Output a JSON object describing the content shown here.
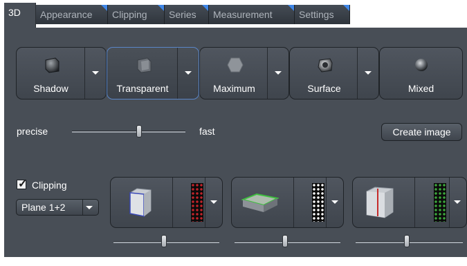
{
  "tabs": [
    {
      "label": "3D",
      "active": true
    },
    {
      "label": "Appearance",
      "active": false
    },
    {
      "label": "Clipping",
      "active": false
    },
    {
      "label": "Series",
      "active": false
    },
    {
      "label": "Measurement",
      "active": false
    },
    {
      "label": "Settings",
      "active": false
    }
  ],
  "render_modes": [
    {
      "label": "Shadow",
      "icon": "shadow-cube-icon",
      "has_dropdown": true,
      "selected": false
    },
    {
      "label": "Transparent",
      "icon": "transparent-cube-icon",
      "has_dropdown": true,
      "selected": true
    },
    {
      "label": "Maximum",
      "icon": "maximum-hexagon-icon",
      "has_dropdown": true,
      "selected": false
    },
    {
      "label": "Surface",
      "icon": "surface-object-icon",
      "has_dropdown": true,
      "selected": false
    },
    {
      "label": "Mixed",
      "icon": "mixed-sphere-icon",
      "has_dropdown": false,
      "selected": false
    }
  ],
  "quality": {
    "left_label": "precise",
    "right_label": "fast",
    "slider_fraction": 0.59
  },
  "create_image_label": "Create image",
  "clipping": {
    "checkbox_label": "Clipping",
    "checked": true,
    "plane_value": "Plane 1+2",
    "planes": [
      {
        "icon": "clip-cube-front-icon",
        "pattern_icon": "clip-pattern-red-icon",
        "slider_fraction": 0.48
      },
      {
        "icon": "clip-slab-green-icon",
        "pattern_icon": "clip-pattern-white-icon",
        "slider_fraction": 0.48
      },
      {
        "icon": "clip-cube-red-plane-icon",
        "pattern_icon": "clip-pattern-green-icon",
        "slider_fraction": 0.48
      }
    ]
  },
  "colors": {
    "panel_bg": "#484e56",
    "tab_corner": "#3f86e6",
    "selected_border": "#5a86c8"
  }
}
